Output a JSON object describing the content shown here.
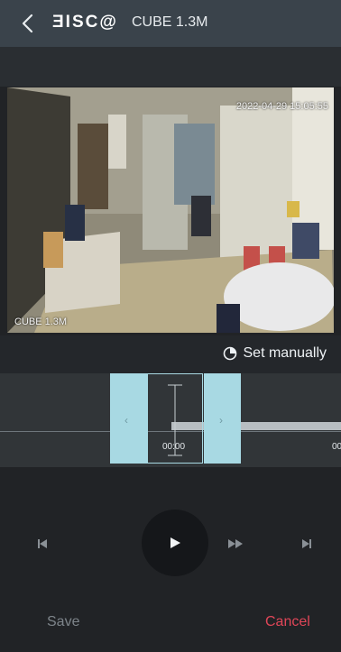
{
  "header": {
    "logo": "ƎISC@",
    "title": "CUBE 1.3M"
  },
  "video": {
    "timestamp": "2022-04-29 15:05:55",
    "camera_label": "CUBE 1.3M"
  },
  "set_manually": {
    "label": "Set manually"
  },
  "timeline": {
    "start_time": "00:00",
    "next_time_partial": "00",
    "left_arrow": "‹",
    "right_arrow": "›"
  },
  "footer": {
    "save": "Save",
    "cancel": "Cancel"
  },
  "colors": {
    "cancel": "#e04658",
    "selection": "#a8d9e3"
  }
}
